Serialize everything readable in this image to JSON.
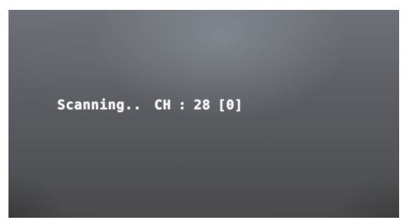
{
  "scan": {
    "status_text": "Scanning..",
    "channel_label": "CH",
    "separator": ":",
    "channel_number": "28",
    "found_count": "[0]"
  }
}
